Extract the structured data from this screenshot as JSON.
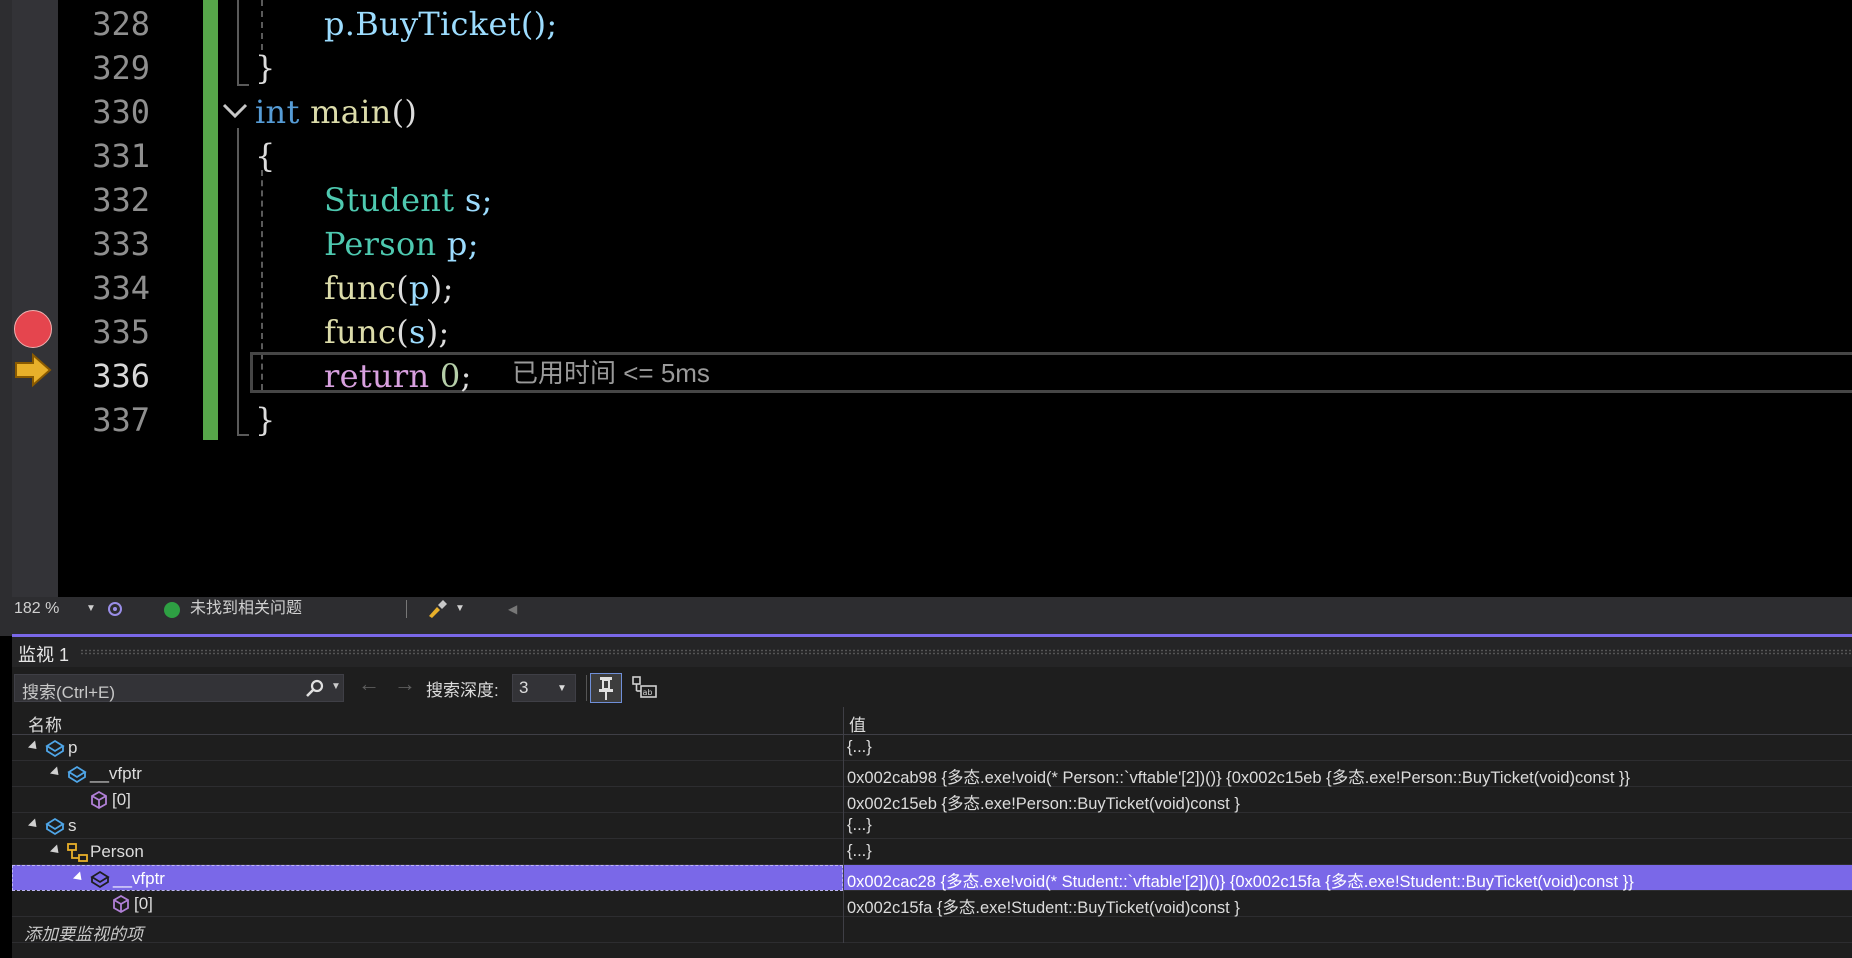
{
  "editor": {
    "lines": [
      {
        "num": "328"
      },
      {
        "num": "329"
      },
      {
        "num": "330"
      },
      {
        "num": "331"
      },
      {
        "num": "332"
      },
      {
        "num": "333"
      },
      {
        "num": "334"
      },
      {
        "num": "335"
      },
      {
        "num": "336"
      },
      {
        "num": "337"
      }
    ],
    "code": {
      "l328": "p.BuyTicket();",
      "l329": "}",
      "l330_kw": "int",
      "l330_fn": "main",
      "l330_rest": "()",
      "l331": "{",
      "l332_type": "Student",
      "l332_rest": " s;",
      "l333_type": "Person",
      "l333_rest": " p;",
      "l334_fn": "func",
      "l334_a": "(",
      "l334_v": "p",
      "l334_b": ");",
      "l335_fn": "func",
      "l335_a": "(",
      "l335_v": "s",
      "l335_b": ");",
      "l336_kw": "return",
      "l336_num": "0",
      "l336_rest": ";",
      "l337": "}"
    },
    "elapsed_hint": "已用时间 <= 5ms",
    "breakpoint_line": "335",
    "current_line": "336"
  },
  "status_bar": {
    "zoom": "182 %",
    "issues": "未找到相关问题"
  },
  "watch": {
    "title": "监视 1",
    "search_placeholder": "搜索(Ctrl+E)",
    "depth_label": "搜索深度:",
    "depth_value": "3",
    "col_name": "名称",
    "col_value": "值",
    "rows": [
      {
        "name": "p",
        "value": "{...}"
      },
      {
        "name": "__vfptr",
        "value": "0x002cab98 {多态.exe!void(* Person::`vftable'[2])()} {0x002c15eb {多态.exe!Person::BuyTicket(void)const }}"
      },
      {
        "name": "[0]",
        "value": "0x002c15eb {多态.exe!Person::BuyTicket(void)const }"
      },
      {
        "name": "s",
        "value": "{...}"
      },
      {
        "name": "Person",
        "value": "{...}"
      },
      {
        "name": "__vfptr",
        "value": "0x002cac28 {多态.exe!void(* Student::`vftable'[2])()} {0x002c15fa {多态.exe!Student::BuyTicket(void)const }}"
      },
      {
        "name": "[0]",
        "value": "0x002c15fa {多态.exe!Student::BuyTicket(void)const }"
      }
    ],
    "add_watch": "添加要监视的项"
  },
  "colors": {
    "accent": "#7a68e8",
    "changebar": "#57a64a",
    "breakpoint": "#e5454e",
    "exec_arrow": "#e8b02a"
  }
}
